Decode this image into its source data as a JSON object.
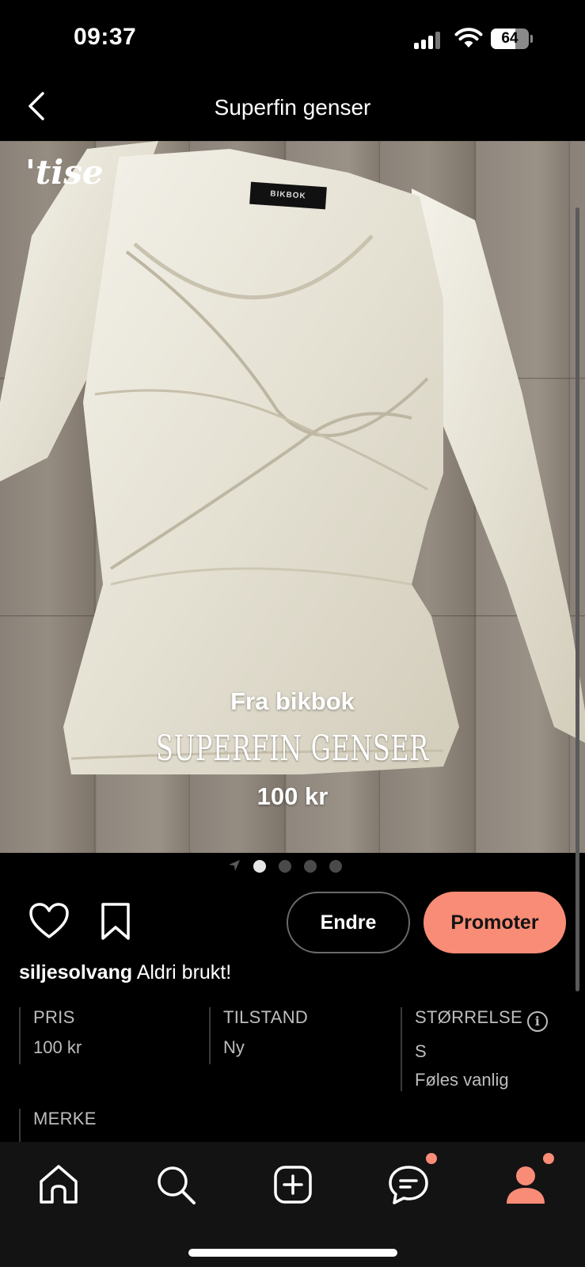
{
  "status_bar": {
    "time": "09:37",
    "battery_level": "64",
    "battery_fraction": 0.64
  },
  "header": {
    "title": "Superfin genser",
    "back_icon": "chevron-left-icon"
  },
  "product_image": {
    "watermark": "'tise",
    "brand_tag": "BIKBOK",
    "overlay_line1": "Fra bikbok",
    "overlay_line2": "SUPERFIN GENSER",
    "overlay_line3": "100 kr"
  },
  "carousel": {
    "total_images": 4,
    "active_index": 0
  },
  "actions": {
    "edit_label": "Endre",
    "promote_label": "Promoter",
    "like_icon": "heart-icon",
    "save_icon": "bookmark-icon"
  },
  "description": {
    "username": "siljesolvang",
    "text": "Aldri brukt!"
  },
  "details": {
    "price_label": "PRIS",
    "price_value": "100 kr",
    "condition_label": "TILSTAND",
    "condition_value": "Ny",
    "size_label": "STØRRELSE",
    "size_info_icon": "info-icon",
    "size_value": "S",
    "size_fit": "Føles vanlig",
    "brand_label": "MERKE"
  },
  "bottom_nav": {
    "items": [
      "home-icon",
      "search-icon",
      "add-icon",
      "chat-icon",
      "profile-icon"
    ],
    "active": "profile-icon",
    "accent_color": "#f98c76"
  },
  "colors": {
    "accent": "#f98c76",
    "background": "#000000"
  }
}
